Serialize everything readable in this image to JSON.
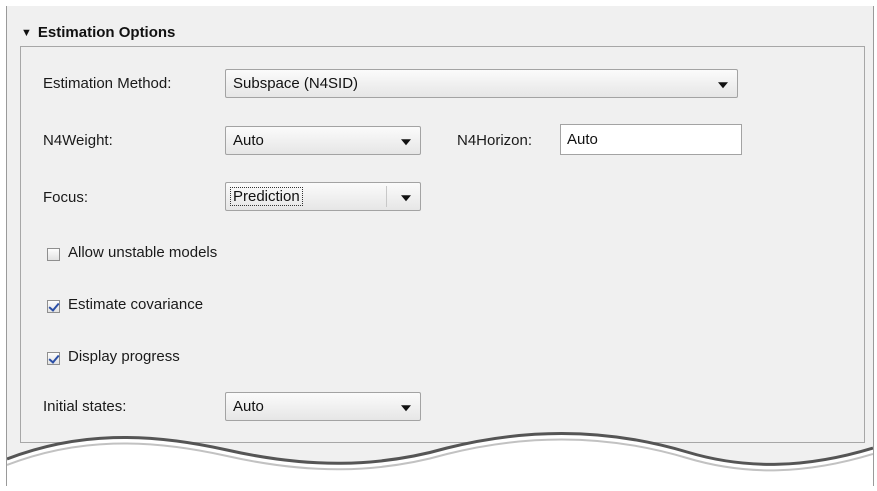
{
  "section": {
    "title": "Estimation Options",
    "icon": "collapse-triangle-icon"
  },
  "fields": {
    "method_label": "Estimation Method:",
    "method_value": "Subspace (N4SID)",
    "n4weight_label": "N4Weight:",
    "n4weight_value": "Auto",
    "n4horizon_label": "N4Horizon:",
    "n4horizon_value": "Auto",
    "focus_label": "Focus:",
    "focus_value": "Prediction",
    "initial_states_label": "Initial states:",
    "initial_states_value": "Auto"
  },
  "checkboxes": [
    {
      "label": "Allow unstable models",
      "checked": false
    },
    {
      "label": "Estimate covariance",
      "checked": true
    },
    {
      "label": "Display progress",
      "checked": true
    }
  ],
  "colors": {
    "panel_bg": "#f0f0f0",
    "checkmark": "#2b4fa6"
  }
}
